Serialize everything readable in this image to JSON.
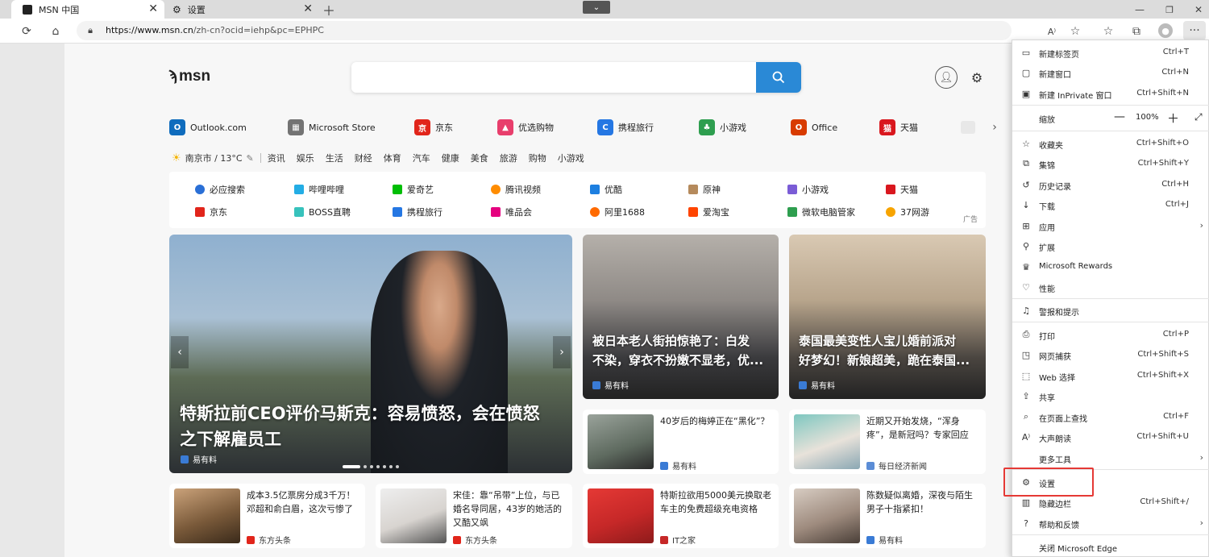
{
  "tabs": [
    {
      "title": "MSN 中国",
      "active": true
    },
    {
      "title": "设置",
      "active": false
    }
  ],
  "address": {
    "url_host": "https://www.msn.cn",
    "url_path": "/zh-cn?ocid=iehp&pc=EPHPC"
  },
  "logo": "msn",
  "quicklinks": [
    {
      "label": "Outlook.com",
      "color": "#0f6cbd"
    },
    {
      "label": "Microsoft Store",
      "color": "#737373"
    },
    {
      "label": "京东",
      "color": "#e1251b"
    },
    {
      "label": "优选购物",
      "color": "#e83e6c"
    },
    {
      "label": "携程旅行",
      "color": "#2577e3"
    },
    {
      "label": "小游戏",
      "color": "#2e9e4f"
    },
    {
      "label": "Office",
      "color": "#d83b01"
    },
    {
      "label": "天猫",
      "color": "#d9171e"
    }
  ],
  "weather": {
    "text": "南京市 / 13°C"
  },
  "categories": [
    "资讯",
    "娱乐",
    "生活",
    "财经",
    "体育",
    "汽车",
    "健康",
    "美食",
    "旅游",
    "购物",
    "小游戏"
  ],
  "sites": [
    [
      "必应搜索",
      "哔哩哔哩",
      "爱奇艺",
      "腾讯视频",
      "优酷",
      "原神",
      "小游戏",
      "天猫"
    ],
    [
      "京东",
      "BOSS直聘",
      "携程旅行",
      "唯品会",
      "阿里1688",
      "爱淘宝",
      "微软电脑管家",
      "37网游"
    ]
  ],
  "ad_label": "广告",
  "hero": {
    "title_l1": "特斯拉前CEO评价马斯克：容易愤怒，会在愤怒",
    "title_l2": "之下解雇员工",
    "source": "易有料"
  },
  "mid_cards": [
    {
      "title_l1": "被日本老人街拍惊艳了：白发",
      "title_l2": "不染，穿衣不扮嫩不显老，优...",
      "source": "易有料"
    },
    {
      "title_l1": "泰国最美变性人宝儿婚前派对",
      "title_l2": "好梦幻！新娘超美，跪在泰国...",
      "source": "易有料"
    }
  ],
  "small_cards_a": [
    {
      "title": "40岁后的梅婷正在“黑化”？",
      "source": "易有料"
    },
    {
      "title": "近期又开始发烧，“浑身疼”，是新冠吗？专家回应",
      "source": "每日经济新闻"
    }
  ],
  "small_cards_b": [
    {
      "title": "成本3.5亿票房分成3千万！邓超和俞白眉，这次亏惨了",
      "source": "东方头条"
    },
    {
      "title": "宋佳：靠“吊带”上位，与已婚名导同居，43岁的她活的又酷又飒",
      "source": "东方头条"
    },
    {
      "title": "特斯拉欲用5000美元换取老车主的免费超级充电资格",
      "source": "IT之家"
    },
    {
      "title": "陈数疑似离婚，深夜与陌生男子十指紧扣！",
      "source": "易有料"
    }
  ],
  "menu": [
    {
      "label": "新建标签页",
      "shortcut": "Ctrl+T",
      "icon": "tab-icon"
    },
    {
      "label": "新建窗口",
      "shortcut": "Ctrl+N",
      "icon": "window-icon"
    },
    {
      "label": "新建 InPrivate 窗口",
      "shortcut": "Ctrl+Shift+N",
      "icon": "inprivate-icon"
    },
    {
      "label": "缩放",
      "zoom": "100%",
      "icon": ""
    },
    {
      "label": "收藏夹",
      "shortcut": "Ctrl+Shift+O",
      "icon": "favorites-icon"
    },
    {
      "label": "集锦",
      "shortcut": "Ctrl+Shift+Y",
      "icon": "collections-icon"
    },
    {
      "label": "历史记录",
      "shortcut": "Ctrl+H",
      "icon": "history-icon"
    },
    {
      "label": "下载",
      "shortcut": "Ctrl+J",
      "icon": "download-icon"
    },
    {
      "label": "应用",
      "shortcut": "",
      "icon": "apps-icon",
      "arrow": true
    },
    {
      "label": "扩展",
      "shortcut": "",
      "icon": "extensions-icon"
    },
    {
      "label": "Microsoft Rewards",
      "shortcut": "",
      "icon": "rewards-icon"
    },
    {
      "label": "性能",
      "shortcut": "",
      "icon": "performance-icon"
    },
    {
      "label": "警报和提示",
      "shortcut": "",
      "icon": "bell-icon"
    },
    {
      "label": "打印",
      "shortcut": "Ctrl+P",
      "icon": "print-icon"
    },
    {
      "label": "网页捕获",
      "shortcut": "Ctrl+Shift+S",
      "icon": "capture-icon"
    },
    {
      "label": "Web 选择",
      "shortcut": "Ctrl+Shift+X",
      "icon": "web-select-icon"
    },
    {
      "label": "共享",
      "shortcut": "",
      "icon": "share-icon"
    },
    {
      "label": "在页面上查找",
      "shortcut": "Ctrl+F",
      "icon": "find-icon"
    },
    {
      "label": "大声朗读",
      "shortcut": "Ctrl+Shift+U",
      "icon": "read-aloud-icon"
    },
    {
      "label": "更多工具",
      "shortcut": "",
      "icon": "",
      "arrow": true
    },
    {
      "label": "设置",
      "shortcut": "",
      "icon": "gear-icon"
    },
    {
      "label": "隐藏边栏",
      "shortcut": "Ctrl+Shift+/",
      "icon": "sidebar-icon"
    },
    {
      "label": "帮助和反馈",
      "shortcut": "",
      "icon": "help-icon",
      "arrow": true
    },
    {
      "label": "关闭 Microsoft Edge",
      "shortcut": "",
      "icon": ""
    }
  ]
}
